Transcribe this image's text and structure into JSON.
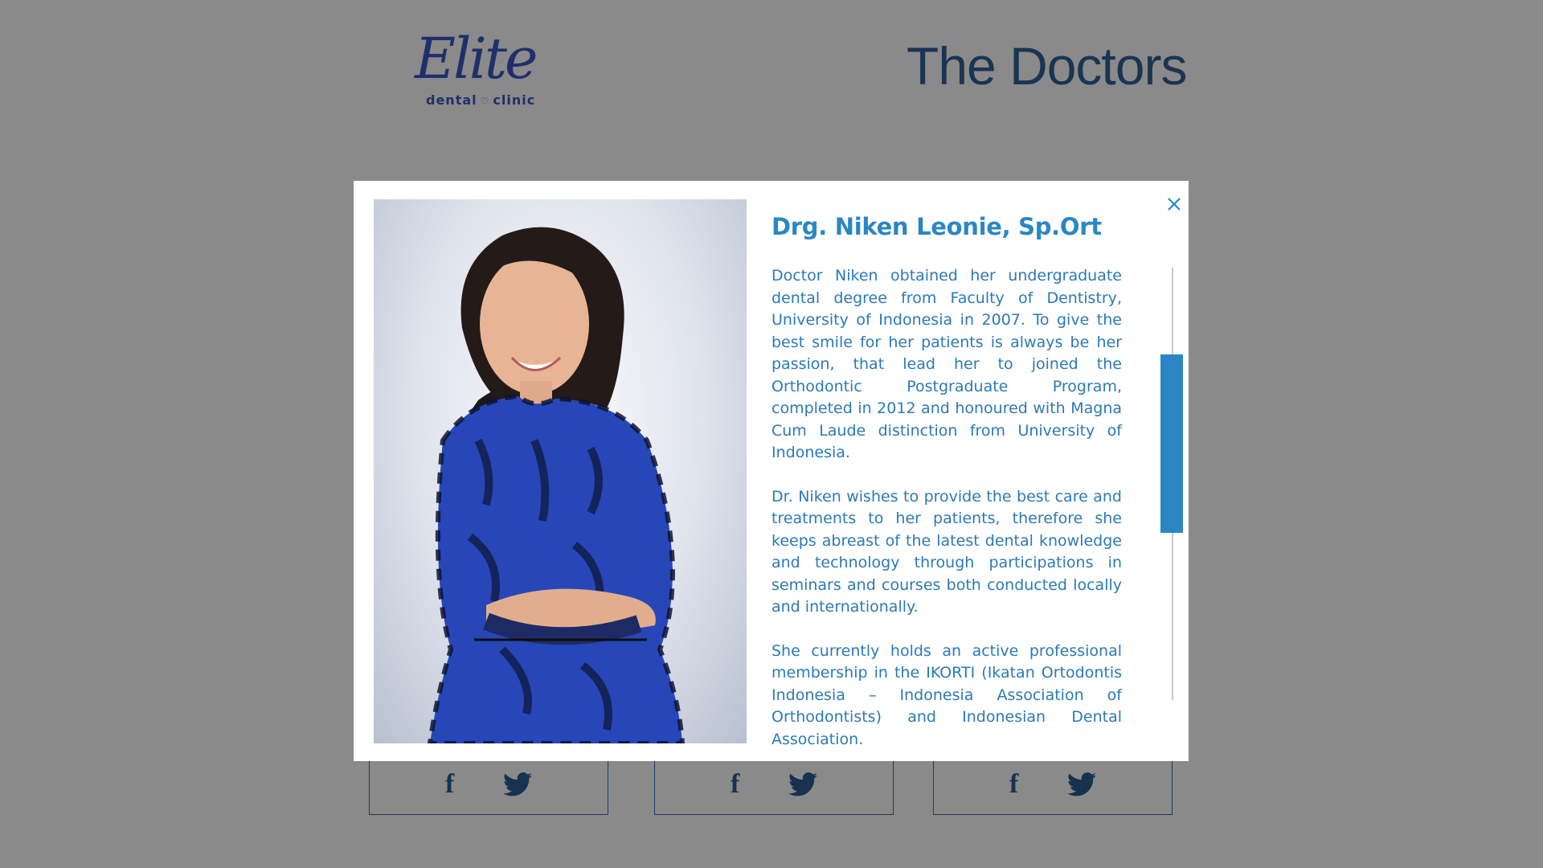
{
  "header": {
    "logo_script": "Elite",
    "logo_sub_left": "dental",
    "logo_sub_right": "clinic",
    "page_title": "The Doctors"
  },
  "modal": {
    "doctor_name": "Drg. Niken Leonie, Sp.Ort",
    "bio": [
      "Doctor Niken obtained her undergraduate dental degree from Faculty of Dentistry, University of Indonesia in 2007. To give the best smile for her patients is always be her passion, that lead her to joined the Orthodontic Postgraduate Program, completed in 2012 and honoured with Magna Cum Laude distinction from University of Indonesia.",
      "Dr. Niken wishes to provide the best care and treatments to her patients, therefore she keeps abreast of the latest dental knowledge and technology through participations in seminars and courses both conducted locally and internationally.",
      "She currently holds an active professional membership in the IKORTI (Ikatan Ortodontis Indonesia – Indonesia Association of Orthodontists) and Indonesian Dental Association."
    ],
    "close_icon": "close-x-icon"
  },
  "cards": [
    {
      "facebook_icon": "facebook-icon",
      "twitter_icon": "twitter-icon"
    },
    {
      "facebook_icon": "facebook-icon",
      "twitter_icon": "twitter-icon"
    },
    {
      "facebook_icon": "facebook-icon",
      "twitter_icon": "twitter-icon"
    }
  ],
  "colors": {
    "accent": "#2a87c3",
    "background": "#8a8a8a",
    "brand_navy": "#1f2f6b",
    "title": "#1a3552",
    "card_border": "#1f3b5c"
  }
}
